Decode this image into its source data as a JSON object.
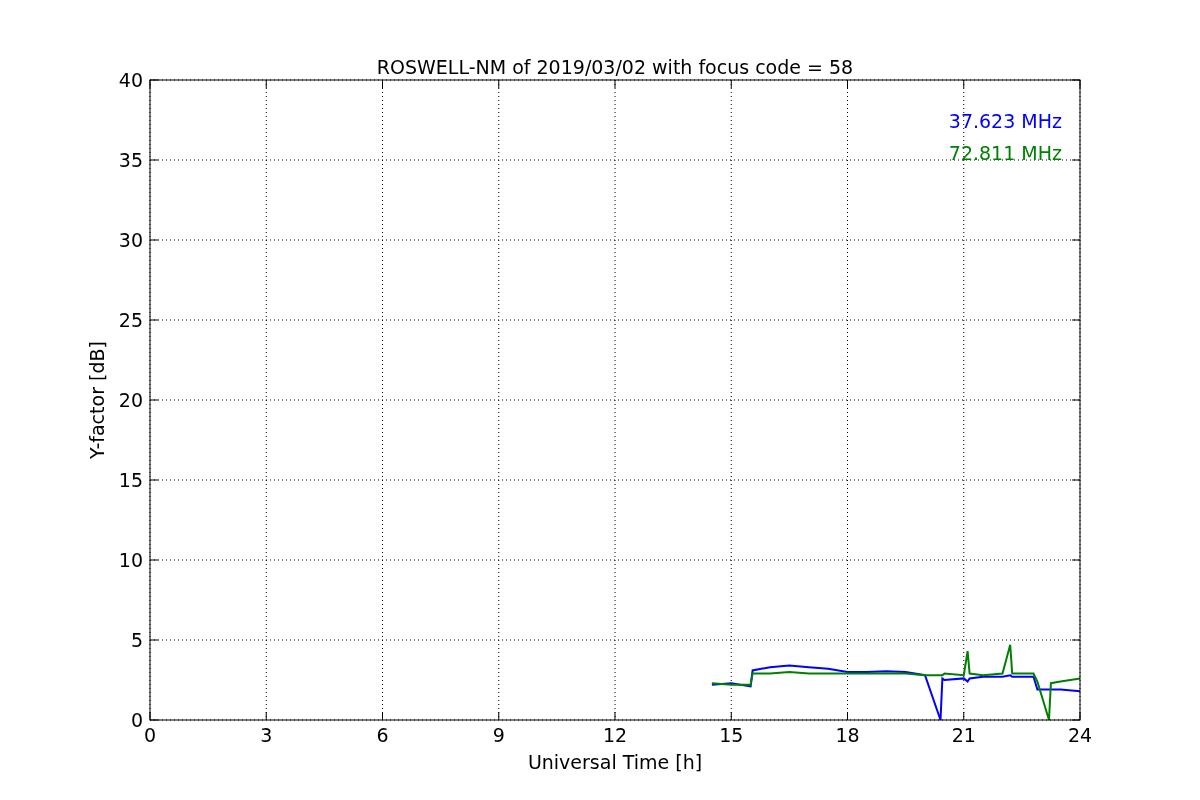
{
  "chart_data": {
    "type": "line",
    "title": "ROSWELL-NM of 2019/03/02 with focus code = 58",
    "xlabel": "Universal Time [h]",
    "ylabel": "Y-factor [dB]",
    "x": [
      14.5,
      15,
      15.5,
      15.55,
      16,
      16.5,
      17,
      17.5,
      18,
      18.5,
      19,
      19.5,
      20,
      20.4,
      20.45,
      20.5,
      21,
      21.1,
      21.15,
      21.5,
      22,
      22.2,
      22.25,
      22.8,
      22.9,
      23.2,
      23.25,
      23.5,
      24
    ],
    "series": [
      {
        "name": "37.623 MHz",
        "color": "#0000ff",
        "values": [
          2.2,
          2.3,
          2.1,
          3.1,
          3.3,
          3.4,
          3.3,
          3.2,
          3.0,
          3.0,
          3.05,
          3.0,
          2.8,
          0,
          2.6,
          2.5,
          2.6,
          2.4,
          2.6,
          2.7,
          2.7,
          2.8,
          2.7,
          2.7,
          1.9,
          1.9,
          1.9,
          1.9,
          1.8
        ]
      },
      {
        "name": "72.811 MHz",
        "color": "#008000",
        "values": [
          2.3,
          2.2,
          2.2,
          2.9,
          2.9,
          3.0,
          2.9,
          2.9,
          2.9,
          2.9,
          2.9,
          2.9,
          2.8,
          2.8,
          2.8,
          2.9,
          2.8,
          4.3,
          2.9,
          2.8,
          2.9,
          4.7,
          2.9,
          2.9,
          2.4,
          0,
          2.3,
          2.4,
          2.6
        ]
      }
    ],
    "grid": true,
    "xlim": [
      0,
      24
    ],
    "ylim": [
      0,
      40
    ],
    "xticks": [
      0,
      3,
      6,
      9,
      12,
      15,
      18,
      21,
      24
    ],
    "yticks": [
      0,
      5,
      10,
      15,
      20,
      25,
      30,
      35,
      40
    ]
  }
}
